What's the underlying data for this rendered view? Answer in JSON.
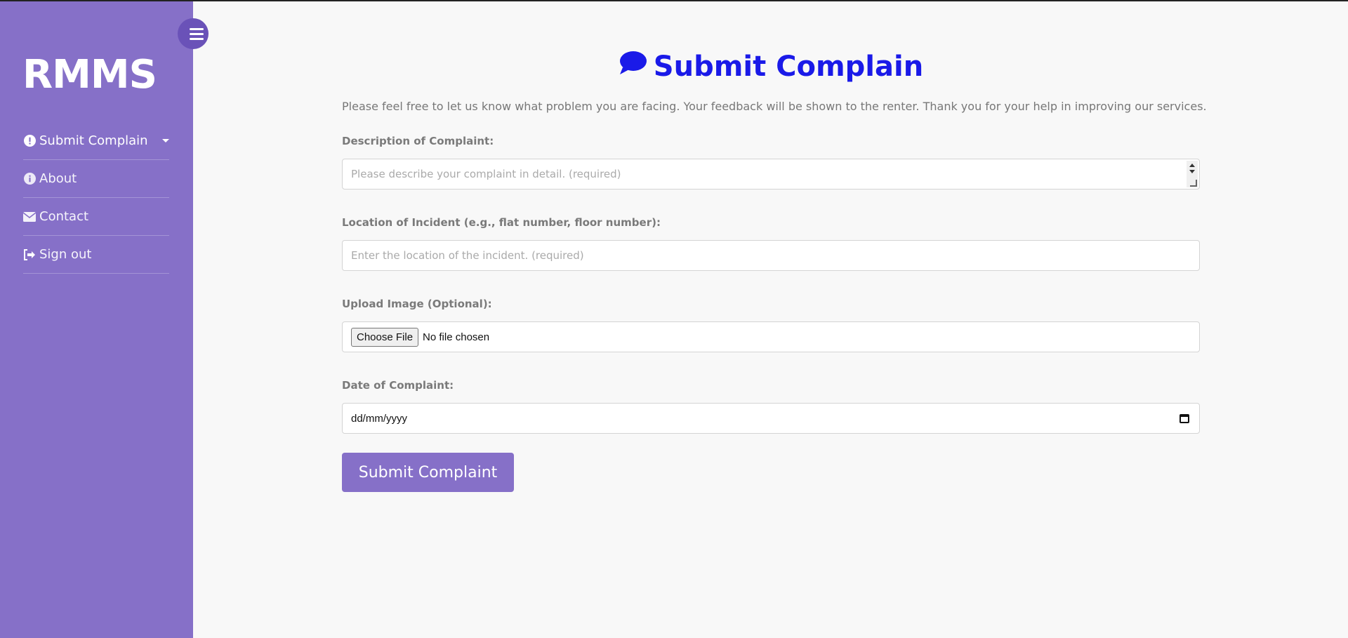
{
  "app": {
    "brand": "RMMS"
  },
  "sidebar": {
    "items": [
      {
        "label": "Submit Complain",
        "icon": "exclamation-circle-icon",
        "active": true,
        "has_caret": true
      },
      {
        "label": "About",
        "icon": "info-circle-icon"
      },
      {
        "label": "Contact",
        "icon": "envelope-icon"
      },
      {
        "label": "Sign out",
        "icon": "sign-out-icon"
      }
    ]
  },
  "main": {
    "title": "Submit Complain",
    "title_icon": "comment-icon",
    "intro": "Please feel free to let us know what problem you are facing. Your feedback will be shown to the renter. Thank you for your help in improving our services.",
    "description": {
      "label": "Description of Complaint:",
      "placeholder": "Please describe your complaint in detail. (required)"
    },
    "location": {
      "label": "Location of Incident (e.g., flat number, floor number):",
      "placeholder": "Enter the location of the incident. (required)"
    },
    "upload": {
      "label": "Upload Image (Optional):",
      "button": "Choose File",
      "status": "No file chosen"
    },
    "date": {
      "label": "Date of Complaint:",
      "value": "dd/mm/yyyy"
    },
    "submit": "Submit Complaint"
  },
  "colors": {
    "sidebar_bg": "#8670c8",
    "title_color": "#1a1ae8",
    "button_bg": "#8670c8"
  }
}
